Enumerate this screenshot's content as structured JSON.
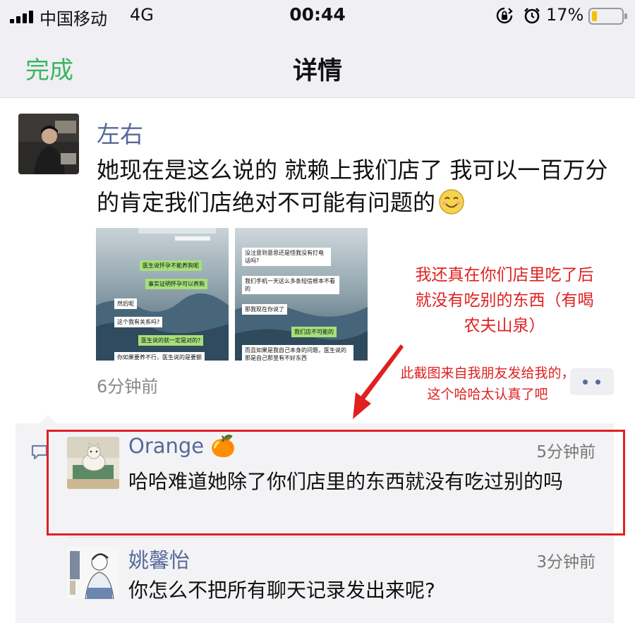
{
  "status_bar": {
    "carrier": "中国移动",
    "network": "4G",
    "time": "00:44",
    "battery_percent": "17%",
    "battery_level": 0.17,
    "battery_color": "#f5c000",
    "icons": [
      "signal-icon",
      "rotation-lock-icon",
      "alarm-icon",
      "battery-icon"
    ]
  },
  "nav": {
    "done_label": "完成",
    "title": "详情",
    "accent": "#3cb65f"
  },
  "post": {
    "author": "左右",
    "text": "她现在是这么说的 就赖上我们店了 我可以一百万分的肯定我们店绝对不可能有问题的",
    "emoji": "smile-emoji",
    "time": "6分钟前",
    "name_color": "#56699a",
    "photos": [
      {
        "bubbles": [
          "医生说怀孕不能养狗呢",
          "事实证明怀孕可以养狗",
          "然后呢",
          "这个我有关系吗?",
          "医生说的就一定是对的?",
          "你如果要养不行，医生说的是要额"
        ]
      },
      {
        "bubbles": [
          "没注意到意思还是怪我没有打电话吗?",
          "我们手机一天这么多条短信根本不看的",
          "那我现在你说了",
          "我们店不可能的",
          "而且如果是我自己本身的问题，医生说的那是自己那里有不好东西"
        ]
      }
    ]
  },
  "annotations": {
    "note1": "我还真在你们店里吃了后就没有吃别的东西（有喝农夫山泉）",
    "note2": "此截图来自我朋友发给我的，这个哈哈太认真了吧",
    "color": "#e02020"
  },
  "comments": [
    {
      "name": "Orange",
      "emoji": "🍊",
      "time": "5分钟前",
      "text": "哈哈难道她除了你们店里的东西就没有吃过别的吗",
      "highlighted": true
    },
    {
      "name": "姚馨怡",
      "time": "3分钟前",
      "text": "你怎么不把所有聊天记录发出来呢?"
    }
  ]
}
